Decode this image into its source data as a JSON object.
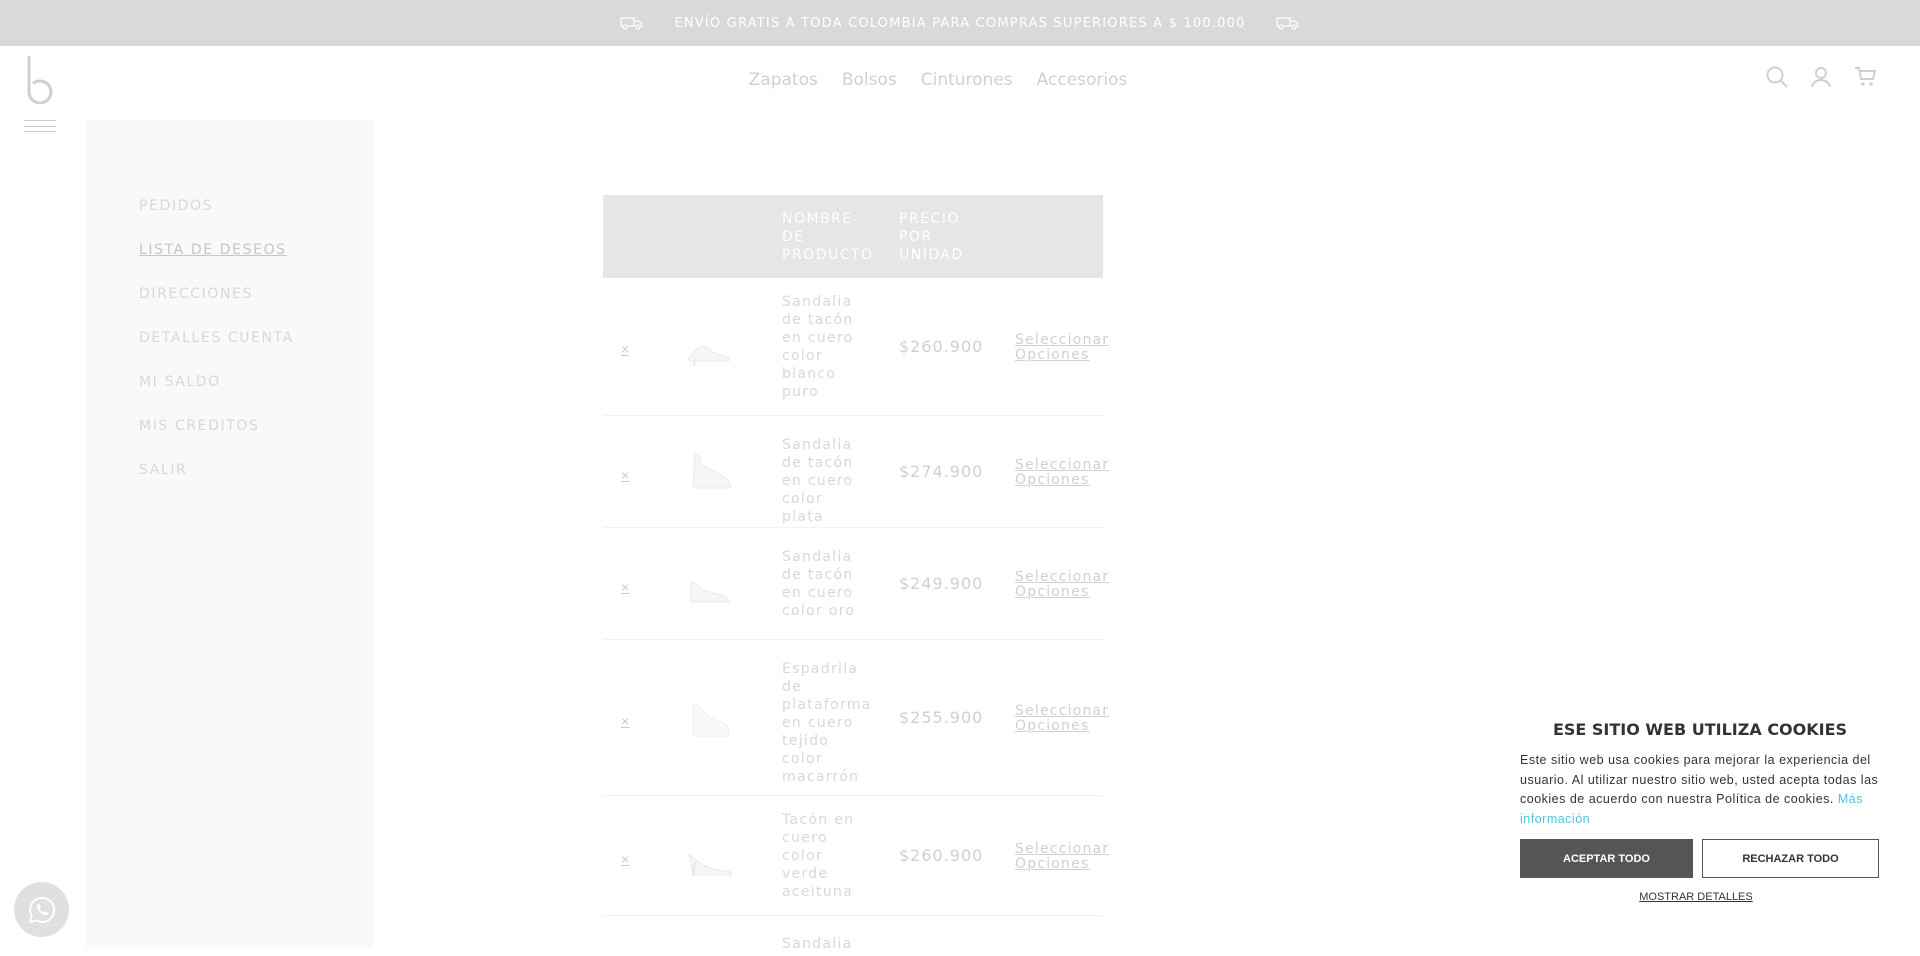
{
  "topbar": {
    "promo": "ENVÍO GRATIS A TODA COLOMBIA PARA COMPRAS SUPERIORES A $ 100.000"
  },
  "header": {
    "nav": [
      "Zapatos",
      "Bolsos",
      "Cinturones",
      "Accesorios"
    ],
    "icons": [
      "search-icon",
      "user-icon",
      "cart-icon"
    ]
  },
  "sidebar": {
    "items": [
      {
        "label": "PEDIDOS"
      },
      {
        "label": "LISTA DE DESEOS",
        "active": true
      },
      {
        "label": "DIRECCIONES"
      },
      {
        "label": "DETALLES CUENTA"
      },
      {
        "label": "MI SALDO"
      },
      {
        "label": "MIS CREDITOS"
      },
      {
        "label": "SALIR"
      }
    ]
  },
  "wishlist": {
    "headers": {
      "name": "NOMBRE DE PRODUCTO",
      "price": "PRECIO POR UNIDAD"
    },
    "rows": [
      {
        "remove": "×",
        "name": "Sandalia de tacón en cuero color blanco puro",
        "price": "$260.900",
        "action": "Seleccionar Opciones"
      },
      {
        "remove": "×",
        "name": "Sandalia de tacón en cuero color plata",
        "price": "$274.900",
        "action": "Seleccionar Opciones"
      },
      {
        "remove": "×",
        "name": "Sandalia de tacón en cuero color oro",
        "price": "$249.900",
        "action": "Seleccionar Opciones"
      },
      {
        "remove": "×",
        "name": "Espadrila de plataforma en cuero tejido color macarrón",
        "price": "$255.900",
        "action": "Seleccionar Opciones"
      },
      {
        "remove": "×",
        "name": "Tacón en cuero color verde aceituna",
        "price": "$260.900",
        "action": "Seleccionar Opciones"
      },
      {
        "remove": "",
        "name": "Sandalia",
        "price": "",
        "action": ""
      }
    ]
  },
  "cookie": {
    "title": "ESE SITIO WEB UTILIZA COOKIES",
    "text": "Este sitio web usa cookies para mejorar la experiencia del usuario. Al utilizar nuestro sitio web, usted acepta todas las cookies de acuerdo con nuestra Política de cookies.",
    "more": "Más información",
    "accept": "ACEPTAR TODO",
    "reject": "RECHAZAR TODO",
    "details": "MOSTRAR DETALLES"
  },
  "whatsapp": {
    "icon": "whatsapp-icon"
  }
}
